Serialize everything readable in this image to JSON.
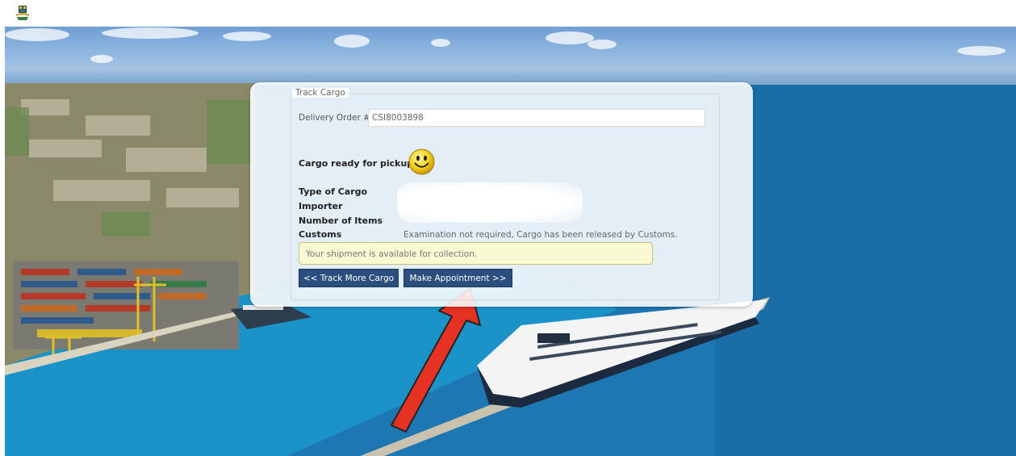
{
  "header": {
    "logo_icon": "coat-of-arms-logo"
  },
  "track_cargo": {
    "legend": "Track Cargo",
    "delivery_order_label": "Delivery Order #",
    "delivery_order_value": "CSI8003898",
    "status_text": "Cargo ready for pickup.",
    "status_icon": "smiley-face-icon",
    "fields": {
      "type_of_cargo_label": "Type of Cargo",
      "importer_label": "Importer",
      "number_of_items_label": "Number of Items",
      "customs_label": "Customs",
      "customs_value": "Examination not required, Cargo has been released by Customs."
    },
    "notice": "Your shipment is available for collection.",
    "buttons": {
      "track_more": "<< Track More Cargo",
      "make_appointment": "Make Appointment >>"
    }
  },
  "colors": {
    "button_bg": "#2a4f7e",
    "notice_bg": "#fafad2",
    "annotation_arrow": "#e53222"
  }
}
